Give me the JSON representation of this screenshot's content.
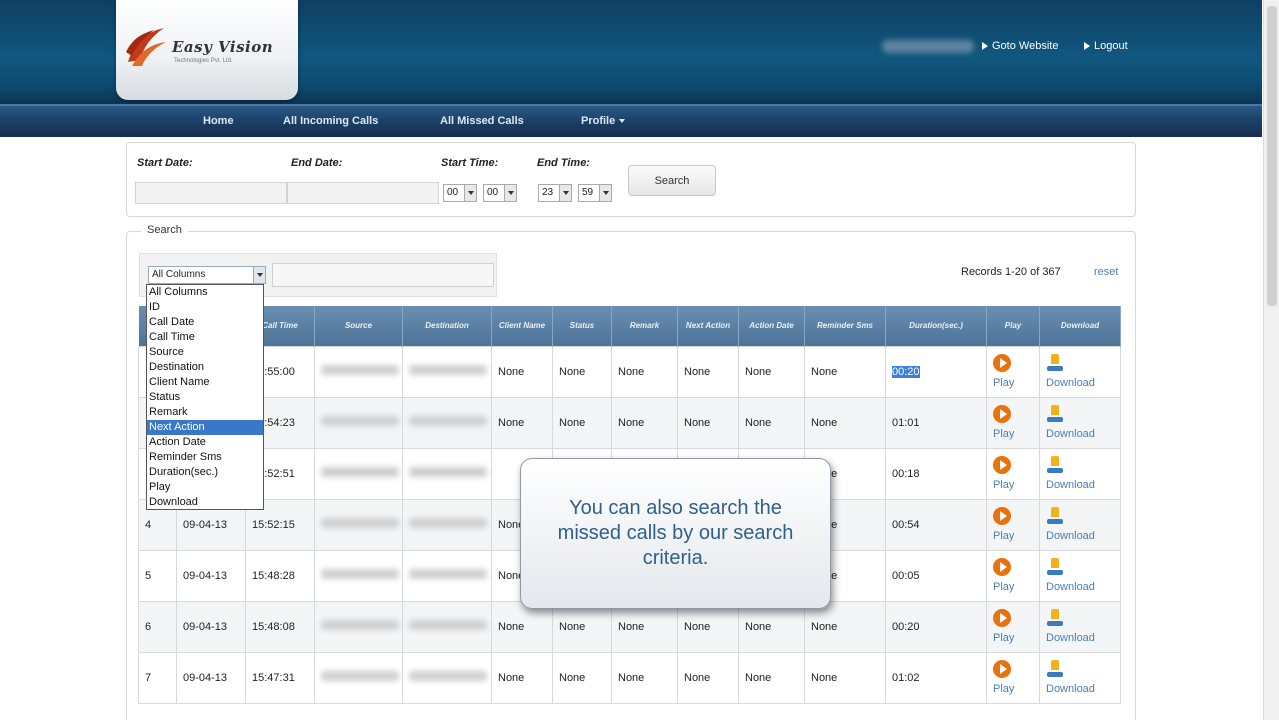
{
  "header": {
    "logo_text": "Easy Vision",
    "logo_subtext": "Technologies Pvt. Ltd.",
    "links": [
      "Goto Website",
      "Logout"
    ]
  },
  "nav": {
    "items": [
      "Home",
      "All Incoming Calls",
      "All Missed Calls",
      "Profile"
    ]
  },
  "filter": {
    "start_date_label": "Start Date:",
    "end_date_label": "End Date:",
    "start_time_label": "Start Time:",
    "end_time_label": "End Time:",
    "start_hour": "00",
    "start_min": "00",
    "end_hour": "23",
    "end_min": "59",
    "search_button": "Search"
  },
  "search": {
    "legend": "Search",
    "column_select": "All Columns",
    "records": "Records 1-20 of 367",
    "reset": "reset",
    "dropdown_options": [
      "All Columns",
      "ID",
      "Call Date",
      "Call Time",
      "Source",
      "Destination",
      "Client Name",
      "Status",
      "Remark",
      "Next Action",
      "Action Date",
      "Reminder Sms",
      "Duration(sec.)",
      "Play",
      "Download"
    ],
    "selected_option": "Next Action"
  },
  "table": {
    "headers": [
      "",
      "",
      "Call Time",
      "Source",
      "Destination",
      "Client Name",
      "Status",
      "Remark",
      "Next Action",
      "Action Date",
      "Reminder Sms",
      "Duration(sec.)",
      "Play",
      "Download"
    ],
    "play_label": "Play",
    "download_label": "Download",
    "rows": [
      {
        "id": "",
        "date": "",
        "time": "15:55:00",
        "client": "None",
        "status": "None",
        "remark": "None",
        "next": "None",
        "action_date": "None",
        "reminder": "None",
        "duration": "00:20"
      },
      {
        "id": "",
        "date": "",
        "time": "15:54:23",
        "client": "None",
        "status": "None",
        "remark": "None",
        "next": "None",
        "action_date": "None",
        "reminder": "None",
        "duration": "01:01"
      },
      {
        "id": "",
        "date": "",
        "time": "15:52:51",
        "client": "",
        "status": "",
        "remark": "",
        "next": "",
        "action_date": "",
        "reminder": "None",
        "duration": "00:18"
      },
      {
        "id": "4",
        "date": "09-04-13",
        "time": "15:52:15",
        "client": "None",
        "status": "",
        "remark": "",
        "next": "",
        "action_date": "",
        "reminder": "None",
        "duration": "00:54"
      },
      {
        "id": "5",
        "date": "09-04-13",
        "time": "15:48:28",
        "client": "None",
        "status": "",
        "remark": "",
        "next": "",
        "action_date": "",
        "reminder": "None",
        "duration": "00:05"
      },
      {
        "id": "6",
        "date": "09-04-13",
        "time": "15:48:08",
        "client": "None",
        "status": "None",
        "remark": "None",
        "next": "None",
        "action_date": "None",
        "reminder": "None",
        "duration": "00:20"
      },
      {
        "id": "7",
        "date": "09-04-13",
        "time": "15:47:31",
        "client": "None",
        "status": "None",
        "remark": "None",
        "next": "None",
        "action_date": "None",
        "reminder": "None",
        "duration": "01:02"
      }
    ]
  },
  "callout": {
    "text": "You can also search the missed calls by our search criteria."
  },
  "colors": {
    "header_bg": "#10577f",
    "nav_bg": "#1b3f66",
    "link": "#4a7fb5",
    "play_orange": "#e8730c"
  }
}
